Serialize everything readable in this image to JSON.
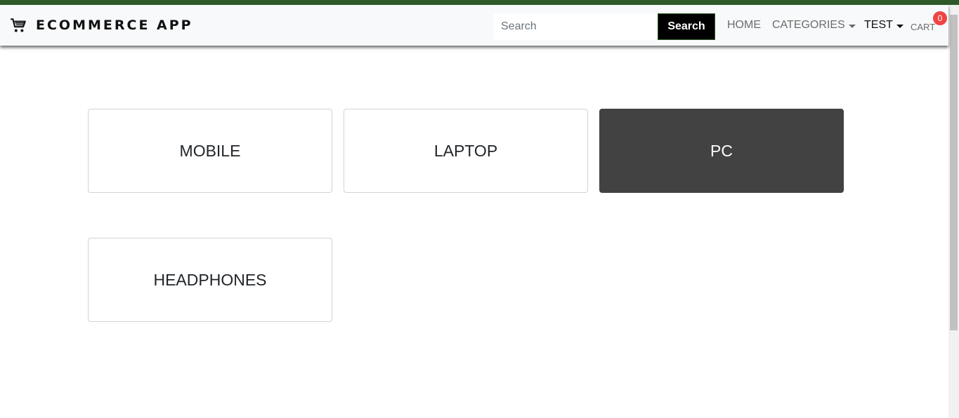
{
  "brand": {
    "icon": "shopping-cart-icon",
    "title": "ECOMMERCE APP"
  },
  "search": {
    "placeholder": "Search",
    "button_label": "Search"
  },
  "nav": {
    "home": "HOME",
    "categories": "CATEGORIES",
    "user": "TEST",
    "cart": "CART",
    "cart_count": "0"
  },
  "categories": [
    {
      "label": "MOBILE",
      "selected": false
    },
    {
      "label": "LAPTOP",
      "selected": false
    },
    {
      "label": "PC",
      "selected": true
    },
    {
      "label": "HEADPHONES",
      "selected": false
    }
  ],
  "colors": {
    "accent_stripe": "#2e5a27",
    "selected_card": "#424242",
    "cart_badge": "#ef4444"
  }
}
